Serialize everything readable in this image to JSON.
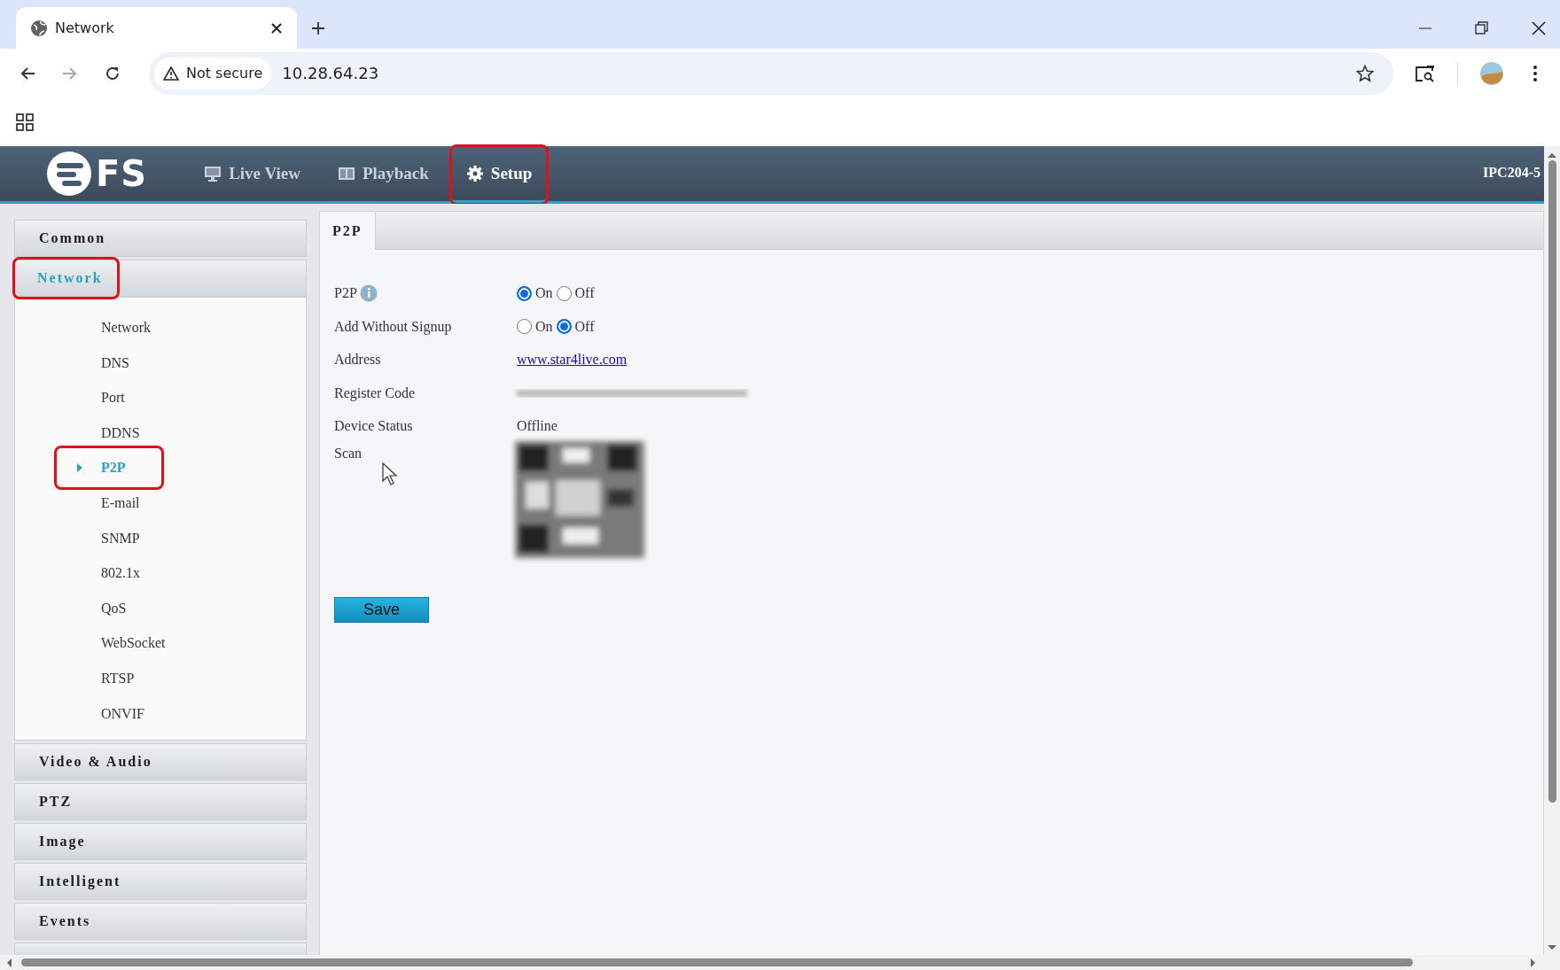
{
  "browser": {
    "tab": {
      "title": "Network"
    },
    "address": {
      "security": "Not secure",
      "url": "10.28.64.23"
    }
  },
  "app": {
    "logo": "FS",
    "nav": [
      {
        "label": "Live View",
        "selected": false,
        "highlighted": false
      },
      {
        "label": "Playback",
        "selected": false,
        "highlighted": false
      },
      {
        "label": "Setup",
        "selected": true,
        "highlighted": true
      }
    ],
    "device": "IPC204-5"
  },
  "sidebar": {
    "sections": [
      {
        "label": "Common",
        "expanded": false,
        "highlighted": false
      },
      {
        "label": "Network",
        "expanded": true,
        "highlighted": true,
        "children": [
          {
            "label": "Network",
            "selected": false,
            "highlighted": false
          },
          {
            "label": "DNS",
            "selected": false,
            "highlighted": false
          },
          {
            "label": "Port",
            "selected": false,
            "highlighted": false
          },
          {
            "label": "DDNS",
            "selected": false,
            "highlighted": false
          },
          {
            "label": "P2P",
            "selected": true,
            "highlighted": true
          },
          {
            "label": "E-mail",
            "selected": false,
            "highlighted": false
          },
          {
            "label": "SNMP",
            "selected": false,
            "highlighted": false
          },
          {
            "label": "802.1x",
            "selected": false,
            "highlighted": false
          },
          {
            "label": "QoS",
            "selected": false,
            "highlighted": false
          },
          {
            "label": "WebSocket",
            "selected": false,
            "highlighted": false
          },
          {
            "label": "RTSP",
            "selected": false,
            "highlighted": false
          },
          {
            "label": "ONVIF",
            "selected": false,
            "highlighted": false
          }
        ]
      },
      {
        "label": "Video & Audio",
        "expanded": false,
        "highlighted": false
      },
      {
        "label": "PTZ",
        "expanded": false,
        "highlighted": false
      },
      {
        "label": "Image",
        "expanded": false,
        "highlighted": false
      },
      {
        "label": "Intelligent",
        "expanded": false,
        "highlighted": false
      },
      {
        "label": "Events",
        "expanded": false,
        "highlighted": false
      }
    ]
  },
  "content": {
    "tabs": [
      {
        "label": "P2P",
        "selected": true
      }
    ],
    "fields": [
      {
        "kind": "radio",
        "label": "P2P",
        "info": true,
        "options": [
          {
            "label": "On",
            "selected": true
          },
          {
            "label": "Off",
            "selected": false
          }
        ]
      },
      {
        "kind": "radio",
        "label": "Add Without Signup",
        "options": [
          {
            "label": "On",
            "selected": false
          },
          {
            "label": "Off",
            "selected": true
          }
        ]
      },
      {
        "kind": "link",
        "label": "Address",
        "value": "www.star4live.com"
      },
      {
        "kind": "blurred",
        "label": "Register Code"
      },
      {
        "kind": "text",
        "label": "Device Status",
        "value": "Offline"
      },
      {
        "kind": "qr",
        "label": "Scan"
      }
    ],
    "save": "Save"
  }
}
